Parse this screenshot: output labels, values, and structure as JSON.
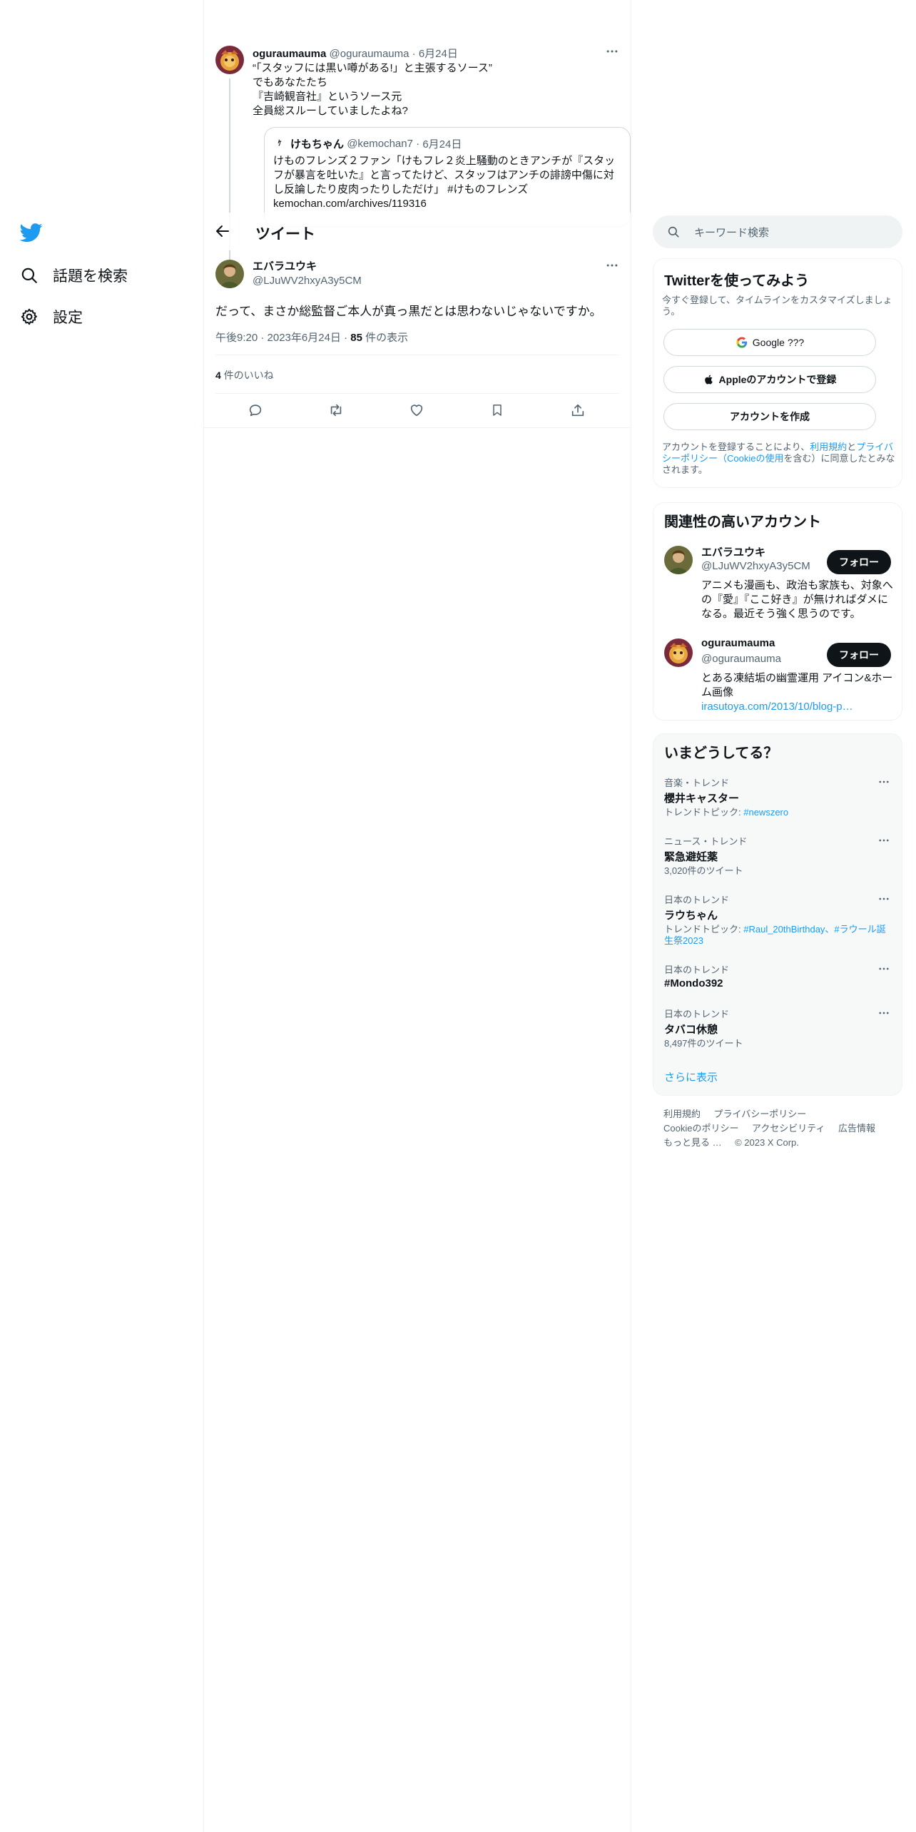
{
  "nav": {
    "items": [
      {
        "label": "話題を検索",
        "icon": "search-icon"
      },
      {
        "label": "設定",
        "icon": "gear-icon"
      }
    ]
  },
  "header": {
    "title": "ツイート"
  },
  "quoted_reply": {
    "name": "oguraumauma",
    "handle": "@oguraumauma",
    "sep": "·",
    "date": "6月24日",
    "lines": [
      "“「スタッフには黒い噂がある!」と主張するソース”",
      "でもあなたたち",
      "『吉崎観音社』というソース元",
      "全員総スルーしていましたよね?"
    ],
    "quote": {
      "name": "けもちゃん",
      "handle": "@kemochan7",
      "sep": "·",
      "date": "6月24日",
      "lines": [
        "けものフレンズ２ファン「けもフレ２炎上騒動のときアンチが『スタッ",
        "フが暴言を吐いた』と言ってたけど、スタッフはアンチの誹謗中傷に対",
        "し反論したり皮肉ったりしただけ」 #けものフレンズ",
        "kemochan.com/archives/119316"
      ]
    }
  },
  "main_tweet": {
    "name": "エバラユウキ",
    "handle": "@LJuWV2hxyA3y5CM",
    "text": "だって、まさか総監督ご本人が真っ黒だとは思わないじゃないですか。",
    "time": "午後9:20 · 2023年6月24日",
    "sep": "·",
    "views_count": "85",
    "views_label": "件の表示",
    "likes_count": "4",
    "likes_label": "件のいいね"
  },
  "search": {
    "placeholder": "キーワード検索"
  },
  "signup": {
    "title": "Twitterを使ってみよう",
    "subtitle": "今すぐ登録して、タイムラインをカスタマイズしましょう。",
    "google_label": "Google ???",
    "apple_label": "Appleのアカウントで登録",
    "create_label": "アカウントを作成",
    "terms_pre": "アカウントを登録することにより、",
    "terms_link1": "利用規約",
    "terms_mid": "と",
    "terms_link2": "プライバシーポリシー",
    "terms_link3": "（Cookieの使用",
    "terms_post": "を含む）に同意したとみなされます。"
  },
  "related": {
    "title": "関連性の高いアカウント",
    "accounts": [
      {
        "name": "エバラユウキ",
        "handle": "@LJuWV2hxyA3y5CM",
        "bio": "アニメも漫画も、政治も家族も、対象への『愛』『ここ好き』が無ければダメになる。最近そう強く思うのです。",
        "link": "",
        "follow": "フォロー"
      },
      {
        "name": "oguraumauma",
        "handle": "@oguraumauma",
        "bio": "とある凍結垢の幽霊運用 アイコン&ホーム画像",
        "link": "irasutoya.com/2013/10/blog-p…",
        "follow": "フォロー"
      }
    ]
  },
  "trends": {
    "title": "いまどうしてる？",
    "items": [
      {
        "category": "音楽・トレンド",
        "name": "櫻井キャスター",
        "sub_pre": "トレンドトピック: ",
        "sub_link": "#newszero",
        "sub": ""
      },
      {
        "category": "ニュース・トレンド",
        "name": "緊急避妊薬",
        "sub_pre": "",
        "sub_link": "",
        "sub": "3,020件のツイート"
      },
      {
        "category": "日本のトレンド",
        "name": "ラウちゃん",
        "sub_pre": "トレンドトピック: ",
        "sub_link": "#Raul_20thBirthday、#ラウール誕生祭2023",
        "sub": ""
      },
      {
        "category": "日本のトレンド",
        "name": "#Mondo392",
        "sub_pre": "",
        "sub_link": "",
        "sub": ""
      },
      {
        "category": "日本のトレンド",
        "name": "タバコ休憩",
        "sub_pre": "",
        "sub_link": "",
        "sub": "8,497件のツイート"
      }
    ],
    "more_label": "さらに表示"
  },
  "footer": {
    "links": [
      "利用規約",
      "プライバシーポリシー",
      "Cookieのポリシー",
      "アクセシビリティ",
      "広告情報",
      "もっと見る …"
    ],
    "copyright": "© 2023 X Corp."
  },
  "colors": {
    "accent": "#1d9bf0",
    "text": "#0f1419",
    "muted": "#536471",
    "border": "#eff3f4",
    "panel": "#f7f9f9"
  }
}
